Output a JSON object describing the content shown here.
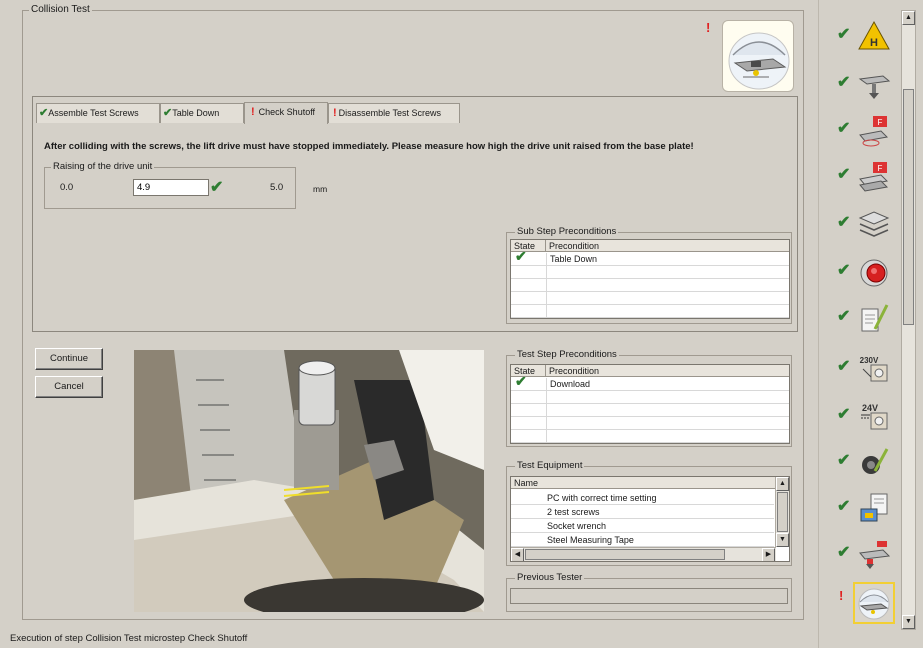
{
  "group_title": "Collision Test",
  "tabs": [
    {
      "label": "Assemble Test Screws",
      "state": "done"
    },
    {
      "label": "Table Down",
      "state": "done"
    },
    {
      "label": "Check Shutoff",
      "state": "warning"
    },
    {
      "label": "Disassemble Test Screws",
      "state": "warning"
    }
  ],
  "instruction": "After colliding with the screws, the lift drive must have stopped immediately. Please measure how high the drive unit raised from the base plate!",
  "raising": {
    "title": "Raising of the drive unit",
    "min": "0.0",
    "value": "4.9",
    "max": "5.0",
    "unit": "mm"
  },
  "sub_step_preconditions": {
    "title": "Sub Step Preconditions",
    "headers": [
      "State",
      "Precondition"
    ],
    "rows": [
      {
        "state": "ok",
        "text": "Table Down"
      }
    ]
  },
  "test_step_preconditions": {
    "title": "Test Step Preconditions",
    "headers": [
      "State",
      "Precondition"
    ],
    "rows": [
      {
        "state": "ok",
        "text": "Download"
      }
    ]
  },
  "test_equipment": {
    "title": "Test Equipment",
    "header": "Name",
    "rows": [
      "PC with correct time setting",
      "2 test screws",
      "Socket wrench",
      "Steel Measuring Tape"
    ]
  },
  "previous_tester": {
    "title": "Previous Tester",
    "value": ""
  },
  "buttons": {
    "continue": "Continue",
    "cancel": "Cancel"
  },
  "status": "Execution of step Collision Test microstep Check Shutoff",
  "sidebar": [
    {
      "icon": "warning-h-icon",
      "state": "done"
    },
    {
      "icon": "table-lift-icon",
      "state": "done"
    },
    {
      "icon": "force-measure-icon",
      "state": "done"
    },
    {
      "icon": "force-stack-icon",
      "state": "done"
    },
    {
      "icon": "layers-icon",
      "state": "done"
    },
    {
      "icon": "emergency-stop-icon",
      "state": "done"
    },
    {
      "icon": "document-sign-icon",
      "state": "done"
    },
    {
      "icon": "voltage-230v-icon",
      "state": "done",
      "text": "230V"
    },
    {
      "icon": "voltage-24v-icon",
      "state": "done",
      "text": "24V"
    },
    {
      "icon": "cable-test-icon",
      "state": "done"
    },
    {
      "icon": "calibration-icon",
      "state": "done"
    },
    {
      "icon": "screws-drive-icon",
      "state": "done"
    },
    {
      "icon": "collision-test-icon",
      "state": "current"
    }
  ],
  "colors": {
    "check": "#2e7d32",
    "warning": "#e02020",
    "highlight": "#f2cf34",
    "panel": "#d4d0c8"
  }
}
